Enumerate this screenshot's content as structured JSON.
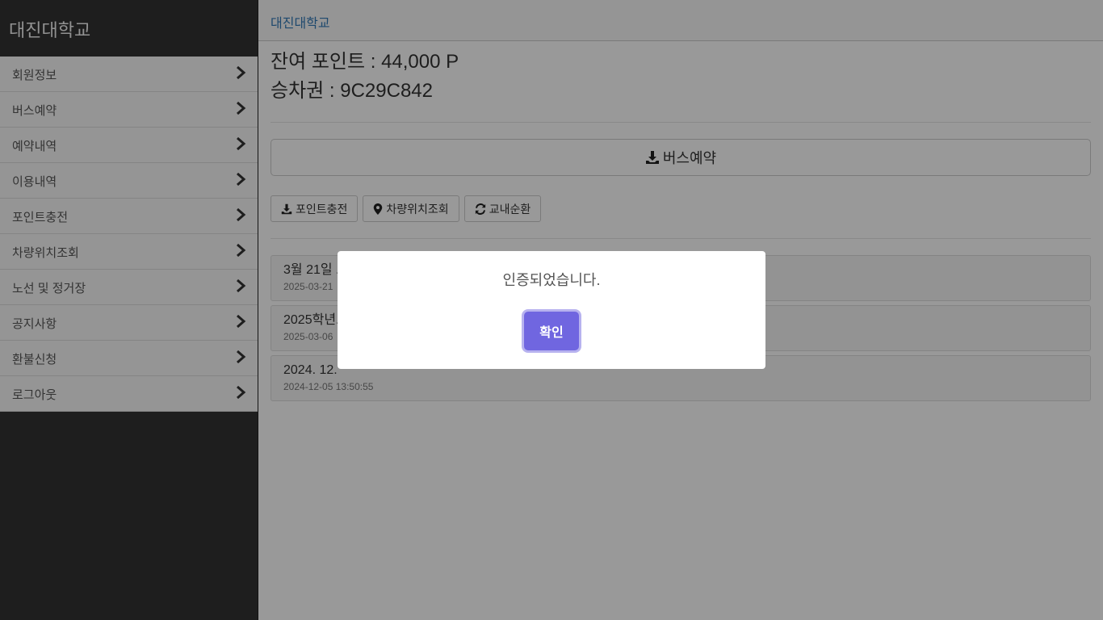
{
  "sidebar": {
    "title": "대진대학교",
    "items": [
      {
        "label": "회원정보"
      },
      {
        "label": "버스예약"
      },
      {
        "label": "예약내역"
      },
      {
        "label": "이용내역"
      },
      {
        "label": "포인트충전"
      },
      {
        "label": "차량위치조회"
      },
      {
        "label": "노선 및 정거장"
      },
      {
        "label": "공지사항"
      },
      {
        "label": "환불신청"
      },
      {
        "label": "로그아웃"
      }
    ]
  },
  "header": {
    "brand": "대진대학교"
  },
  "account": {
    "points": "잔여 포인트 : 44,000 P",
    "ticket": "승차권 : 9C29C842"
  },
  "actions": {
    "bus_reserve": "버스예약",
    "point_charge": "포인트충전",
    "vehicle_location": "차량위치조회",
    "campus_loop": "교내순환"
  },
  "notices": [
    {
      "title": "3월 21일 ...",
      "date": "2025-03-21"
    },
    {
      "title": "2025학년...",
      "date": "2025-03-06"
    },
    {
      "title": "2024. 12.",
      "date": "2024-12-05 13:50:55"
    }
  ],
  "modal": {
    "message": "인증되었습니다.",
    "confirm": "확인",
    "accent": "#7066e0"
  }
}
